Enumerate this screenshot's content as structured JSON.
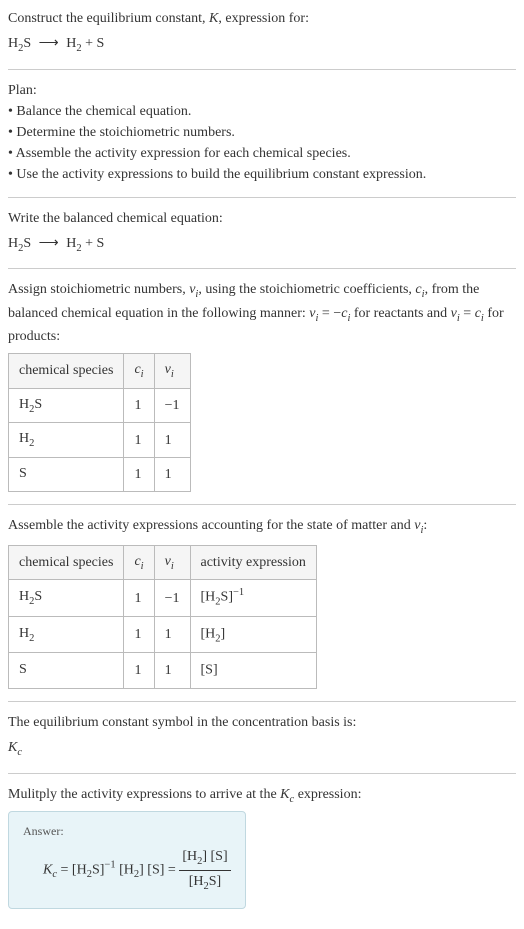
{
  "header": {
    "title_prefix": "Construct the equilibrium constant, ",
    "title_k": "K",
    "title_suffix": ", expression for:",
    "reaction_lhs": "H",
    "reaction_lhs_sub": "2",
    "reaction_lhs2": "S",
    "arrow": "⟶",
    "reaction_rhs1": "H",
    "reaction_rhs1_sub": "2",
    "reaction_plus": " + ",
    "reaction_rhs2": "S"
  },
  "plan": {
    "heading": "Plan:",
    "items": [
      "Balance the chemical equation.",
      "Determine the stoichiometric numbers.",
      "Assemble the activity expression for each chemical species.",
      "Use the activity expressions to build the equilibrium constant expression."
    ]
  },
  "balanced": {
    "intro": "Write the balanced chemical equation:"
  },
  "stoich": {
    "intro_p1": "Assign stoichiometric numbers, ",
    "nu": "ν",
    "nu_sub": "i",
    "intro_p2": ", using the stoichiometric coefficients, ",
    "c": "c",
    "c_sub": "i",
    "intro_p3": ", from the balanced chemical equation in the following manner: ",
    "rel1_lhs": "ν",
    "rel1_eq": " = −",
    "rel1_rhs": "c",
    "intro_p4": " for reactants and ",
    "rel2_eq": " = ",
    "intro_p5": " for products:",
    "headers": {
      "species": "chemical species",
      "c": "c",
      "c_sub": "i",
      "nu": "ν",
      "nu_sub": "i"
    },
    "rows": [
      {
        "species_a": "H",
        "species_sub": "2",
        "species_b": "S",
        "c": "1",
        "nu": "−1"
      },
      {
        "species_a": "H",
        "species_sub": "2",
        "species_b": "",
        "c": "1",
        "nu": "1"
      },
      {
        "species_a": "S",
        "species_sub": "",
        "species_b": "",
        "c": "1",
        "nu": "1"
      }
    ]
  },
  "activity": {
    "intro_p1": "Assemble the activity expressions accounting for the state of matter and ",
    "intro_p2": ":",
    "headers": {
      "species": "chemical species",
      "activity": "activity expression"
    },
    "rows": [
      {
        "species_a": "H",
        "species_sub": "2",
        "species_b": "S",
        "c": "1",
        "nu": "−1",
        "act_open": "[H",
        "act_sub": "2",
        "act_mid": "S]",
        "act_sup": "−1"
      },
      {
        "species_a": "H",
        "species_sub": "2",
        "species_b": "",
        "c": "1",
        "nu": "1",
        "act_open": "[H",
        "act_sub": "2",
        "act_mid": "]",
        "act_sup": ""
      },
      {
        "species_a": "S",
        "species_sub": "",
        "species_b": "",
        "c": "1",
        "nu": "1",
        "act_open": "[S]",
        "act_sub": "",
        "act_mid": "",
        "act_sup": ""
      }
    ]
  },
  "eq_symbol": {
    "intro": "The equilibrium constant symbol in the concentration basis is:",
    "k": "K",
    "k_sub": "c"
  },
  "multiply": {
    "intro_p1": "Mulitply the activity expressions to arrive at the ",
    "intro_p2": " expression:"
  },
  "answer": {
    "label": "Answer:",
    "k": "K",
    "k_sub": "c",
    "eq": " = ",
    "term1_open": "[H",
    "term1_sub": "2",
    "term1_mid": "S]",
    "term1_sup": "−1",
    "sp": " ",
    "term2_open": "[H",
    "term2_sub": "2",
    "term2_close": "]",
    "term3": "[S]",
    "eq2": " = ",
    "num_p1": "[H",
    "num_sub": "2",
    "num_p2": "] [S]",
    "den_p1": "[H",
    "den_sub": "2",
    "den_p2": "S]"
  }
}
